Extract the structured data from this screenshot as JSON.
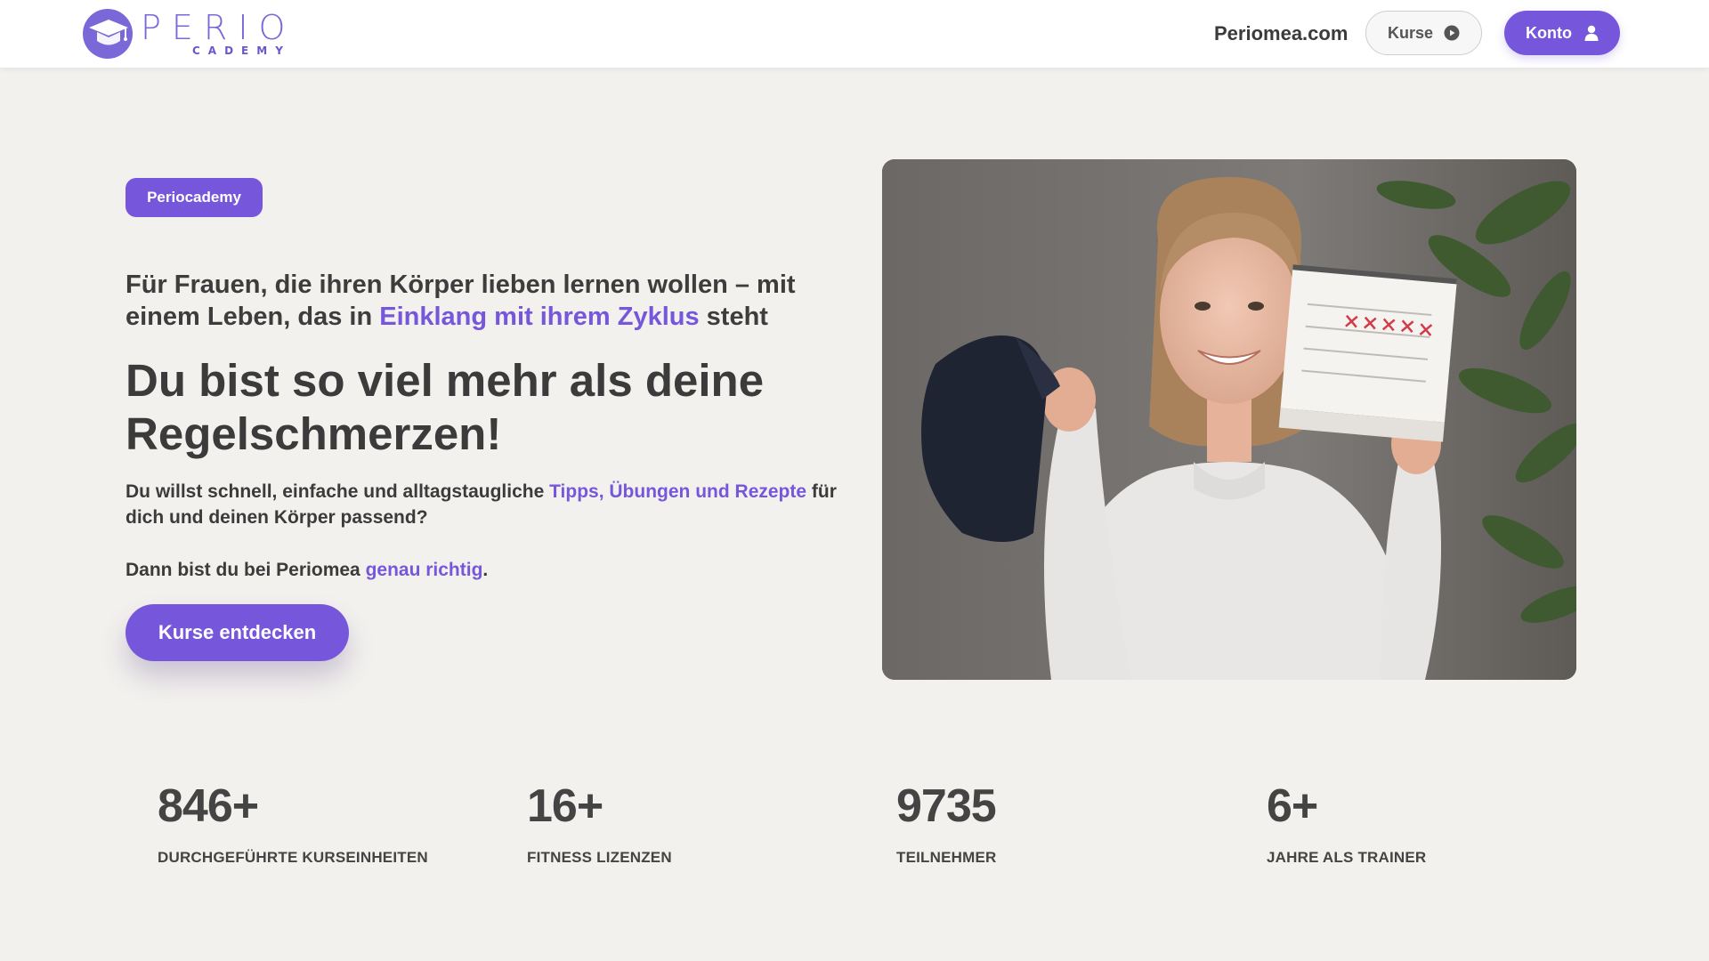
{
  "header": {
    "logo_top": "PERIO",
    "logo_bottom": "CADEMY",
    "nav_link": "Periomea.com",
    "kurse_button": "Kurse",
    "konto_button": "Konto"
  },
  "hero": {
    "badge": "Periocademy",
    "subtitle_part1": "Für Frauen, die ihren Körper lieben lernen wollen – mit einem Leben, das in ",
    "subtitle_accent": "Einklang mit ihrem Zyklus",
    "subtitle_part2": " steht",
    "headline": "Du bist so viel mehr als deine Regelschmerzen!",
    "body1_part1": "Du willst schnell, einfache und alltagstaugliche ",
    "body1_accent": "Tipps, Übungen und Rezepte",
    "body1_part2": " für dich und deinen Körper passend?",
    "body2_part1": "Dann bist du bei Periomea ",
    "body2_accent": "genau richtig",
    "body2_part2": ".",
    "cta": "Kurse entdecken"
  },
  "stats": [
    {
      "value": "846+",
      "label": "DURCHGEFÜHRTE KURSEINHEITEN"
    },
    {
      "value": "16+",
      "label": "FITNESS LIZENZEN"
    },
    {
      "value": "9735",
      "label": "TEILNEHMER"
    },
    {
      "value": "6+",
      "label": "JAHRE ALS TRAINER"
    }
  ],
  "colors": {
    "accent": "#7657db",
    "background": "#f3f1ee",
    "text": "#3b3b3b"
  },
  "icons": {
    "logo": "graduation-cap-logo-icon",
    "kurse": "play-circle-icon",
    "konto": "user-icon"
  }
}
